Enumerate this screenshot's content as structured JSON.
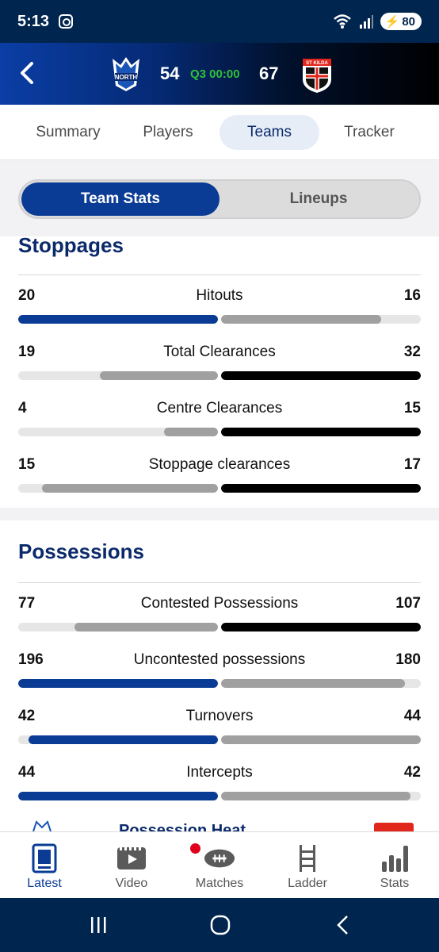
{
  "status": {
    "time": "5:13",
    "battery": "80"
  },
  "match": {
    "home_score": "54",
    "away_score": "67",
    "clock": "Q3 00:00",
    "home_logo_text": "NORTH",
    "away_logo_text": "ST KILDA"
  },
  "tabs": [
    {
      "label": "Summary"
    },
    {
      "label": "Players"
    },
    {
      "label": "Teams"
    },
    {
      "label": "Tracker"
    }
  ],
  "segment": {
    "team_stats": "Team Stats",
    "lineups": "Lineups"
  },
  "colors": {
    "home": "#0a3c96",
    "away": "#000000",
    "neutral": "#a0a0a0"
  },
  "sections": [
    {
      "title": "Stoppages",
      "stats": [
        {
          "label": "Hitouts",
          "home": "20",
          "away": "16",
          "home_frac": 1.0,
          "away_frac": 0.8,
          "home_color": "home",
          "away_color": "neutral"
        },
        {
          "label": "Total Clearances",
          "home": "19",
          "away": "32",
          "home_frac": 0.59,
          "away_frac": 1.0,
          "home_color": "neutral",
          "away_color": "away"
        },
        {
          "label": "Centre Clearances",
          "home": "4",
          "away": "15",
          "home_frac": 0.27,
          "away_frac": 1.0,
          "home_color": "neutral",
          "away_color": "away"
        },
        {
          "label": "Stoppage clearances",
          "home": "15",
          "away": "17",
          "home_frac": 0.88,
          "away_frac": 1.0,
          "home_color": "neutral",
          "away_color": "away"
        }
      ]
    },
    {
      "title": "Possessions",
      "stats": [
        {
          "label": "Contested Possessions",
          "home": "77",
          "away": "107",
          "home_frac": 0.72,
          "away_frac": 1.0,
          "home_color": "neutral",
          "away_color": "away"
        },
        {
          "label": "Uncontested possessions",
          "home": "196",
          "away": "180",
          "home_frac": 1.0,
          "away_frac": 0.92,
          "home_color": "home",
          "away_color": "neutral"
        },
        {
          "label": "Turnovers",
          "home": "42",
          "away": "44",
          "home_frac": 0.95,
          "away_frac": 1.0,
          "home_color": "home",
          "away_color": "neutral"
        },
        {
          "label": "Intercepts",
          "home": "44",
          "away": "42",
          "home_frac": 1.0,
          "away_frac": 0.95,
          "home_color": "home",
          "away_color": "neutral"
        }
      ]
    }
  ],
  "peek_title": "Possession Heat",
  "bottom_nav": [
    {
      "label": "Latest",
      "icon": "latest-icon"
    },
    {
      "label": "Video",
      "icon": "video-icon"
    },
    {
      "label": "Matches",
      "icon": "football-icon"
    },
    {
      "label": "Ladder",
      "icon": "ladder-icon"
    },
    {
      "label": "Stats",
      "icon": "stats-icon"
    }
  ]
}
